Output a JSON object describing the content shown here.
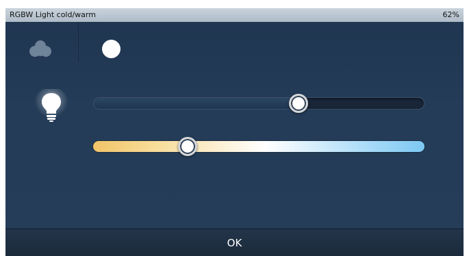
{
  "window": {
    "title": "RGBW Light cold/warm",
    "percentage": "62%"
  },
  "modes": {
    "color_icon": "cloud-icon",
    "white_icon": "white-circle-icon",
    "selected": "white"
  },
  "brightness": {
    "icon": "lightbulb-icon",
    "value_fraction": 0.62
  },
  "color_temperature": {
    "value_fraction": 0.285,
    "colors": {
      "warm": "#f2c468",
      "neutral": "#ffffff",
      "cold": "#7cc8f2"
    }
  },
  "footer": {
    "ok_label": "OK"
  },
  "colors": {
    "background": "#243c58",
    "titlebar": "#b8c4cf",
    "footer": "#1f2f42"
  }
}
